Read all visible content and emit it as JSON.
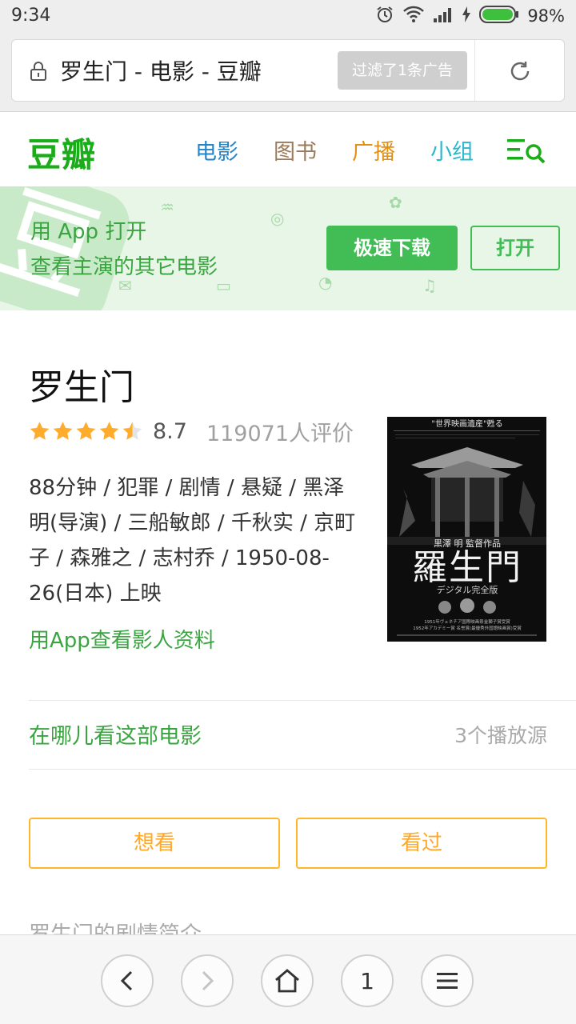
{
  "status_bar": {
    "time": "9:34",
    "battery_percent": "98%",
    "icons": [
      "alarm-icon",
      "wifi-icon",
      "signal-icon",
      "charging-icon",
      "battery-icon"
    ]
  },
  "url_bar": {
    "page_title": "罗生门 - 电影 - 豆瓣",
    "ad_filter_label": "过滤了1条广告",
    "icons": [
      "lock-icon",
      "reload-icon"
    ]
  },
  "site_header": {
    "logo": "豆瓣",
    "nav": [
      {
        "label": "电影",
        "color": "#2384c8"
      },
      {
        "label": "图书",
        "color": "#9c7a5a"
      },
      {
        "label": "广播",
        "color": "#e09015"
      },
      {
        "label": "小组",
        "color": "#2ab8cc"
      }
    ],
    "brand_color": "#1aad19"
  },
  "promo": {
    "line1": "用 App 打开",
    "line2": "查看主演的其它电影",
    "download_label": "极速下载",
    "open_label": "打开",
    "accent": "#42bd56"
  },
  "movie": {
    "title": "罗生门",
    "rating_stars": 4.5,
    "score": "8.7",
    "votes": "119071人评价",
    "meta": "88分钟 / 犯罪 / 剧情 / 悬疑 / 黑泽明(导演) / 三船敏郎 / 千秋实 / 京町子 / 森雅之 / 志村乔 / 1950-08-26(日本) 上映",
    "app_people_link": "用App查看影人资料",
    "poster": {
      "top_caption": "\"世界映画遺産\"甦る",
      "director_line": "黒澤 明 監督作品",
      "title": "羅生門",
      "subtitle": "デジタル完全版",
      "award1": "1951年ヴェネチア国際映画祭金獅子賞受賞",
      "award2": "1952年アカデミー賞 名誉賞(最優秀外国語映画賞)受賞"
    }
  },
  "where_to_watch": {
    "label": "在哪儿看这部电影",
    "sources": "3个播放源"
  },
  "actions": {
    "want_label": "想看",
    "seen_label": "看过"
  },
  "synopsis_heading": "罗生门的剧情简介",
  "bottom_bar": {
    "tab_count": "1",
    "icons": [
      "back-icon",
      "forward-icon",
      "home-icon",
      "tabs-icon",
      "menu-icon"
    ]
  }
}
